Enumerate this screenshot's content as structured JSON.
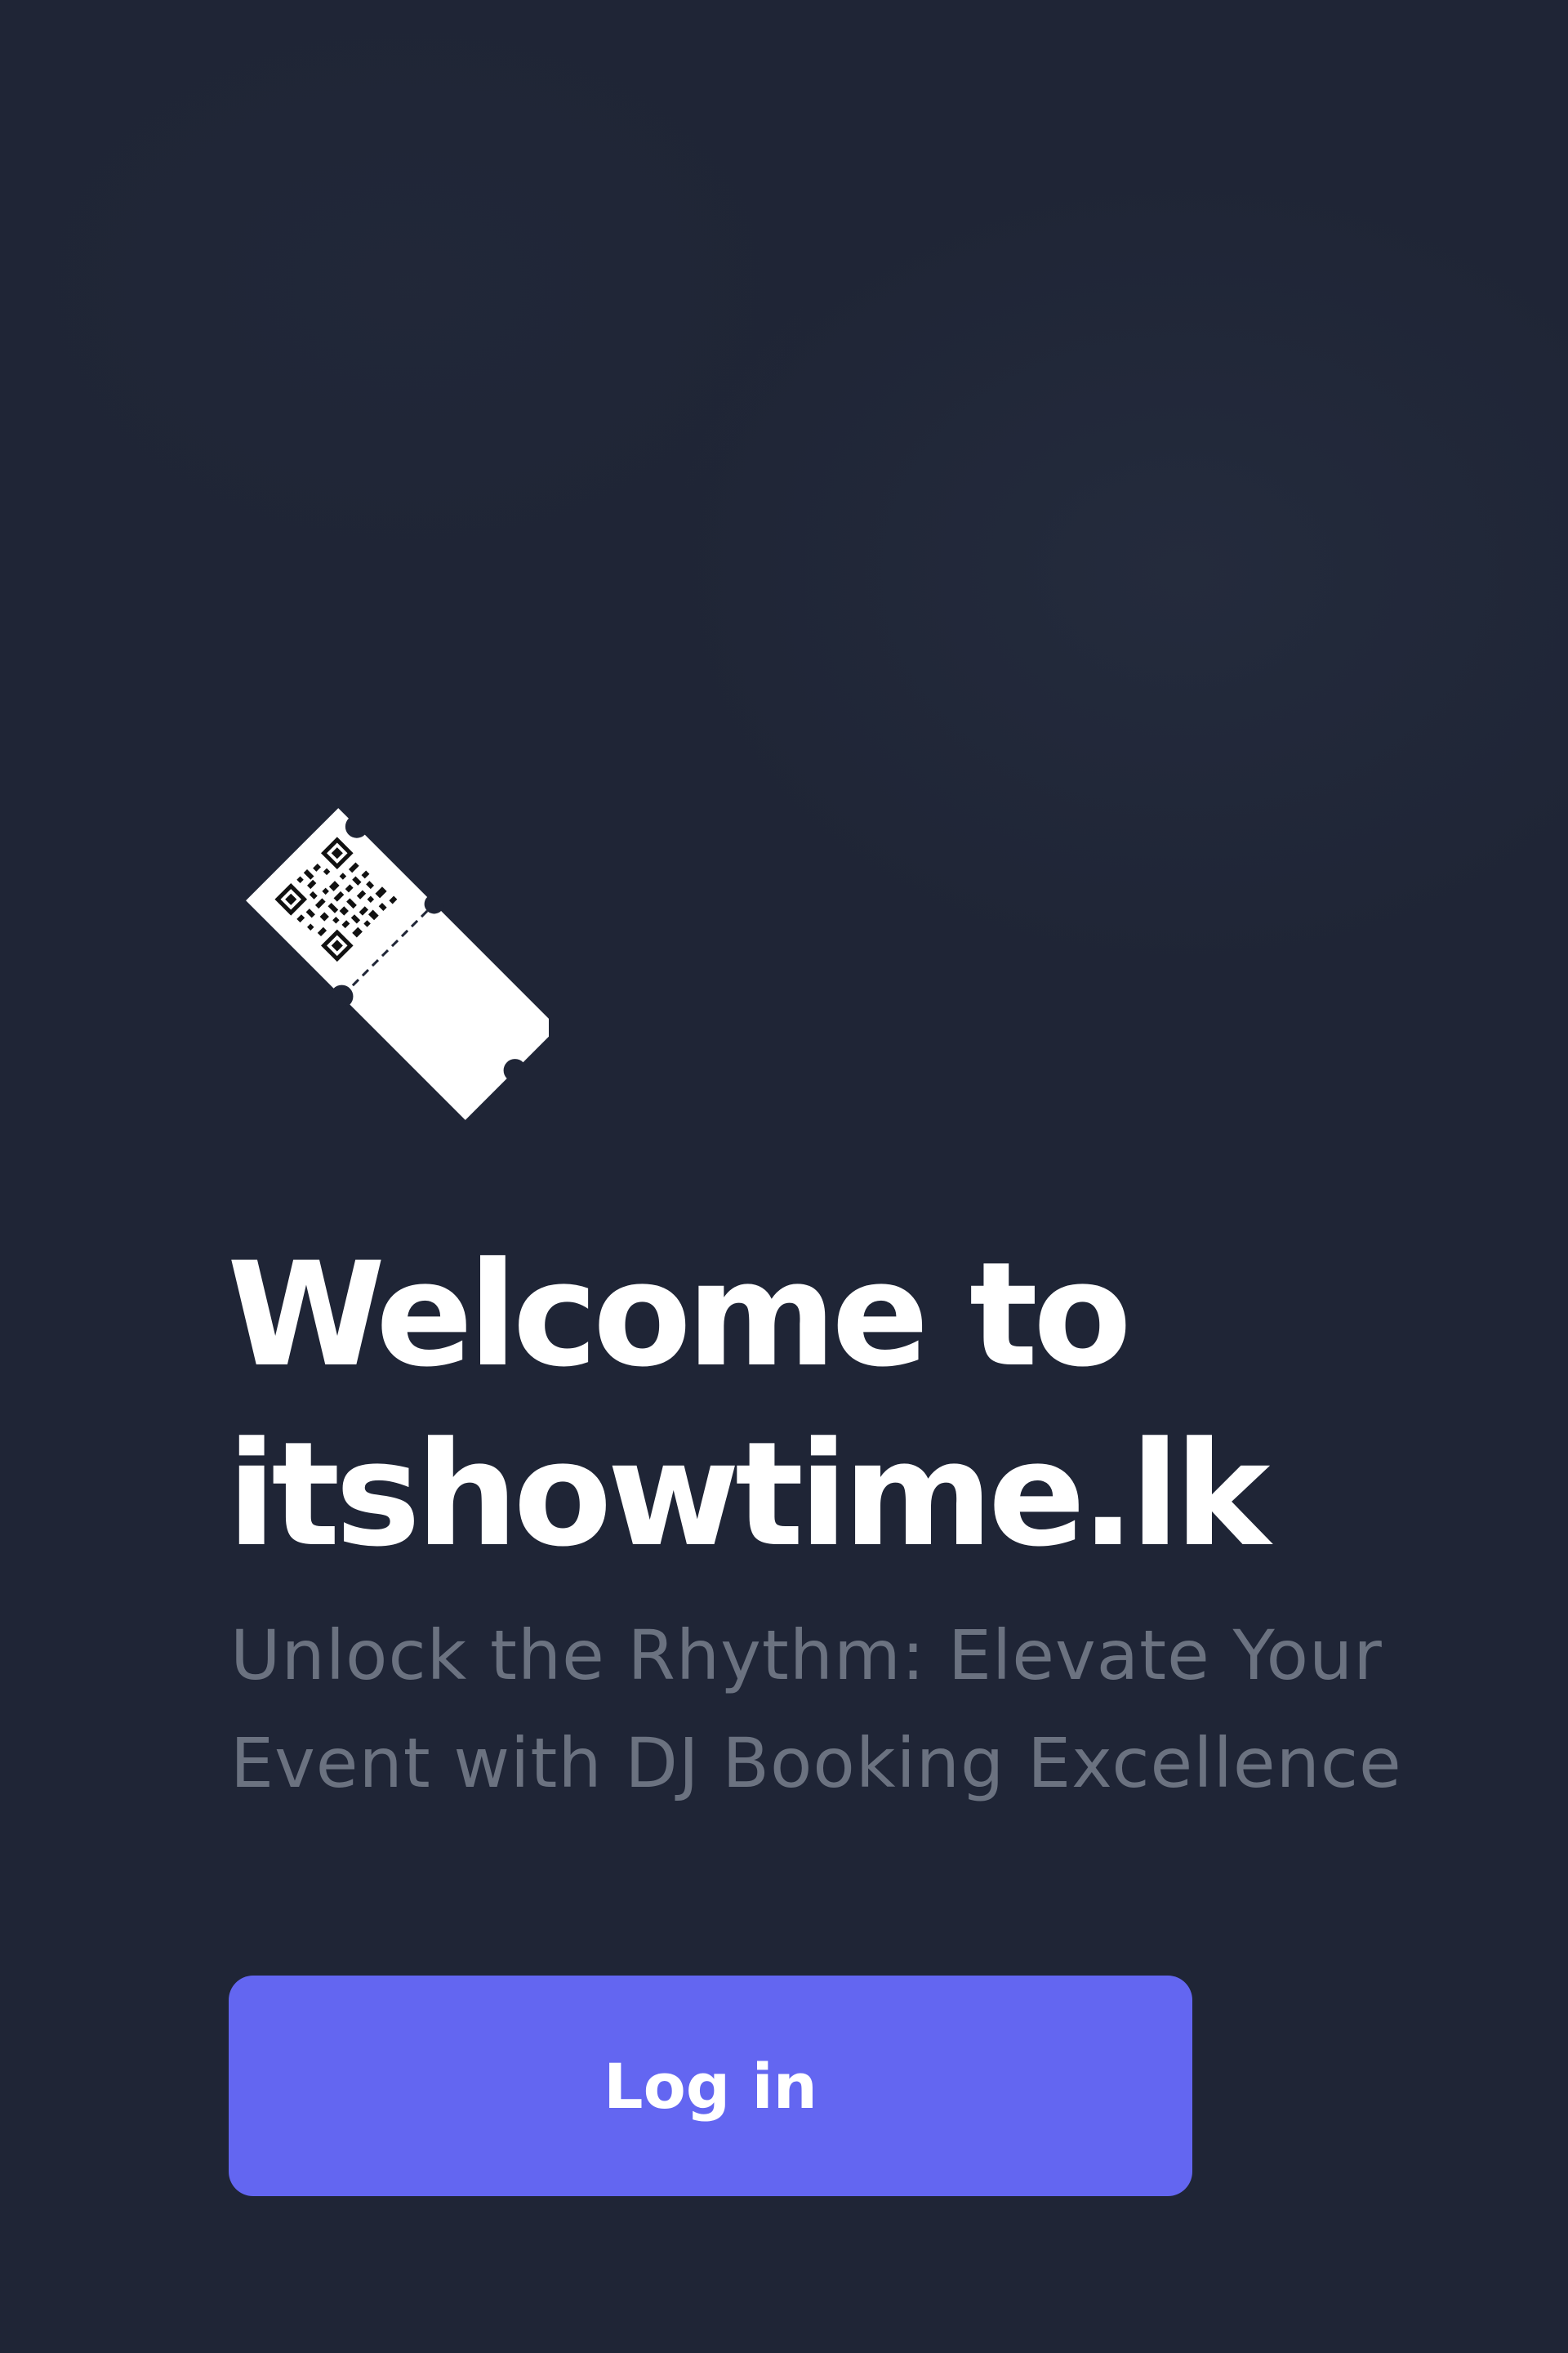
{
  "welcome": {
    "title_line1": "Welcome to",
    "title_line2": "itshowtime.lk",
    "subtitle_line1": "Unlock the Rhythm: Elevate Your",
    "subtitle_line2": "Event with DJ Booking Excellence"
  },
  "actions": {
    "login_label": "Log in"
  },
  "icons": {
    "logo": "ticket-qr-icon"
  },
  "colors": {
    "background": "#1f2536",
    "accent": "#6366f1",
    "title": "#ffffff",
    "subtitle": "#6b7280"
  }
}
